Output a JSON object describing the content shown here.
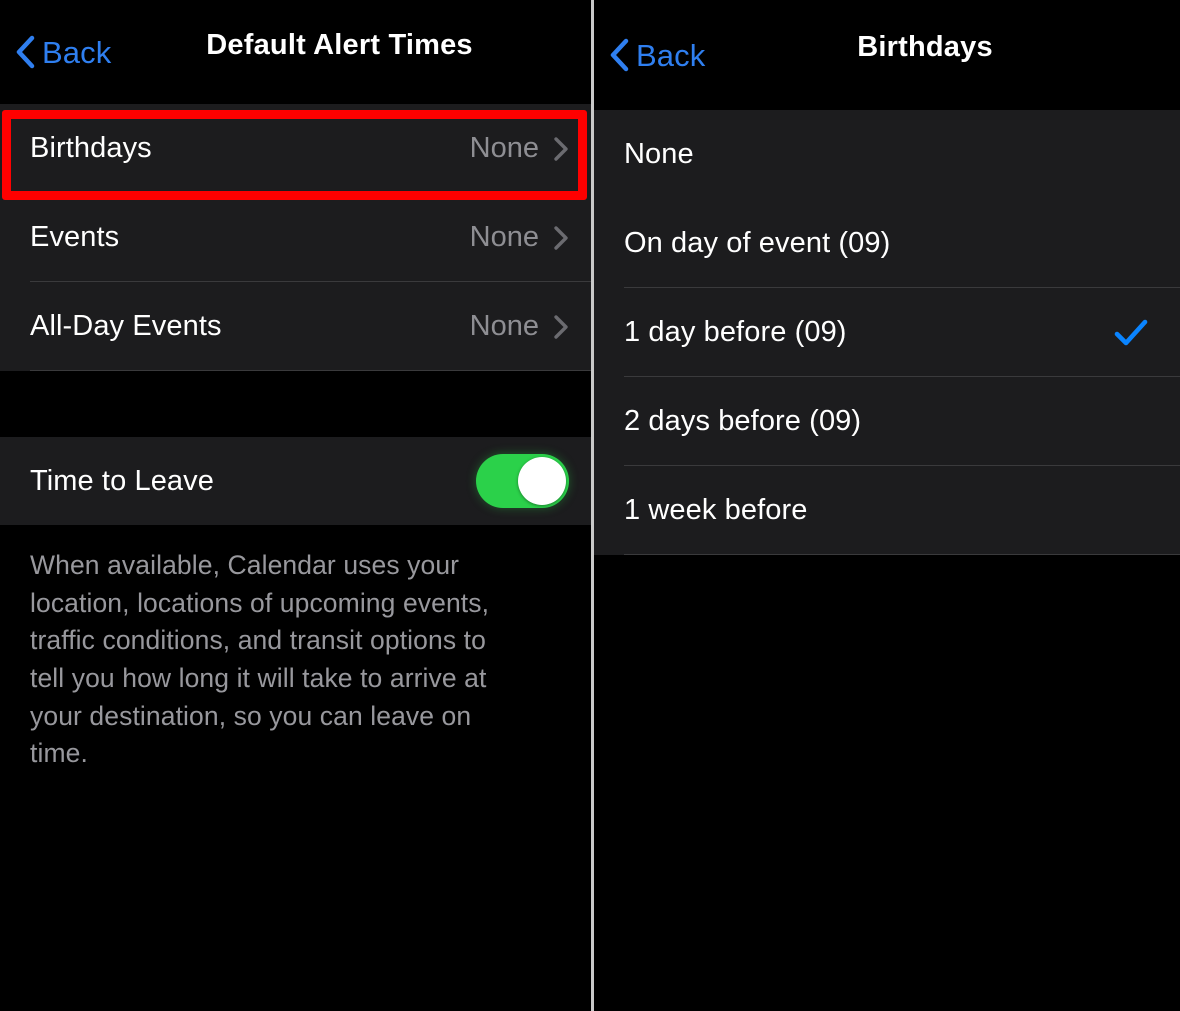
{
  "colors": {
    "background": "#000000",
    "group_background": "#1c1c1e",
    "separator": "#3a3a3c",
    "accent_blue": "#2f7ff0",
    "check_blue": "#0a84ff",
    "value_gray": "#8e8e93",
    "note_gray": "#98989d",
    "toggle_on_green": "#2bd14a",
    "annotation_red": "#ff0000",
    "panel_divider": "#c9c9c9"
  },
  "left_panel": {
    "nav": {
      "back_label": "Back",
      "back_icon": "chevron-left-icon",
      "title": "Default Alert Times"
    },
    "alert_rows": [
      {
        "label": "Birthdays",
        "value": "None",
        "chevron_icon": "chevron-right-icon",
        "highlighted": "true"
      },
      {
        "label": "Events",
        "value": "None",
        "chevron_icon": "chevron-right-icon",
        "highlighted": "false"
      },
      {
        "label": "All-Day Events",
        "value": "None",
        "chevron_icon": "chevron-right-icon",
        "highlighted": "false"
      }
    ],
    "time_to_leave": {
      "label": "Time to Leave",
      "toggle_state": "on",
      "toggle_icon": "toggle-switch-on-icon"
    },
    "footer_note": "When available, Calendar uses your location, locations of upcoming events, traffic conditions, and transit options to tell you how long it will take to arrive at your destination, so you can leave on time."
  },
  "right_panel": {
    "nav": {
      "back_label": "Back",
      "back_icon": "chevron-left-icon",
      "title": "Birthdays"
    },
    "options": [
      {
        "label": "None",
        "selected": "false",
        "check_icon": ""
      },
      {
        "label": "On day of event (09)",
        "selected": "false",
        "check_icon": ""
      },
      {
        "label": "1 day before (09)",
        "selected": "true",
        "check_icon": "checkmark-icon"
      },
      {
        "label": "2 days before (09)",
        "selected": "false",
        "check_icon": ""
      },
      {
        "label": "1 week before",
        "selected": "false",
        "check_icon": ""
      }
    ]
  },
  "annotations": {
    "highlight_box": {
      "target": "Birthdays",
      "color": "#ff0000",
      "shape": "rectangle-outline"
    },
    "arrow": {
      "target": "1 day before (09)",
      "color": "#ff0000",
      "shape": "arrow-pointing-left"
    }
  }
}
